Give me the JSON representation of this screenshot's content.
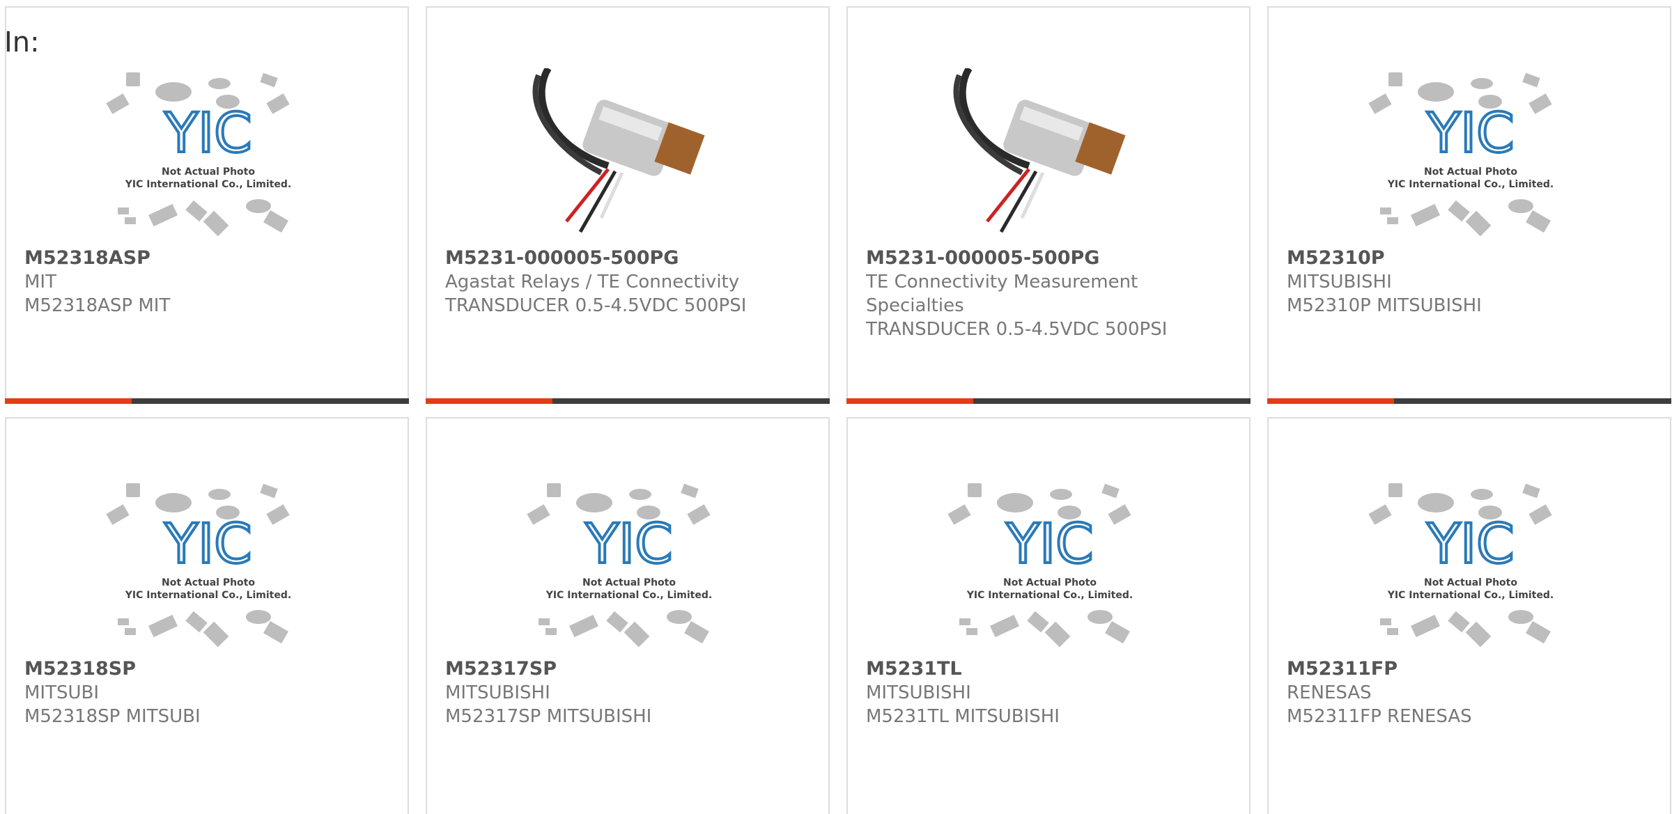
{
  "page": {
    "intro_text": "In:"
  },
  "colors": {
    "accent": "#e53c13",
    "bar_dark": "#3d3d3d",
    "card_border": "#dddddd",
    "logo_blue": "#2a7ab8"
  },
  "placeholder_image": {
    "icon": "yic-placeholder-image",
    "caption_line1": "Not Actual Photo",
    "caption_line2": "YIC International Co., Limited."
  },
  "products": [
    {
      "part": "M52318ASP",
      "mfr": "MIT",
      "desc": "M52318ASP MIT",
      "image": "yic-placeholder-image"
    },
    {
      "part": "M5231-000005-500PG",
      "mfr": "Agastat Relays / TE Connectivity",
      "desc": "TRANSDUCER 0.5-4.5VDC 500PSI",
      "image": "pressure-transducer-photo"
    },
    {
      "part": "M5231-000005-500PG",
      "mfr": "TE Connectivity Measurement Specialties",
      "desc": "TRANSDUCER 0.5-4.5VDC 500PSI",
      "image": "pressure-transducer-photo"
    },
    {
      "part": "M52310P",
      "mfr": "MITSUBISHI",
      "desc": "M52310P MITSUBISHI",
      "image": "yic-placeholder-image"
    },
    {
      "part": "M52318SP",
      "mfr": "MITSUBI",
      "desc": "M52318SP MITSUBI",
      "image": "yic-placeholder-image"
    },
    {
      "part": "M52317SP",
      "mfr": "MITSUBISHI",
      "desc": "M52317SP MITSUBISHI",
      "image": "yic-placeholder-image"
    },
    {
      "part": "M5231TL",
      "mfr": "MITSUBISHI",
      "desc": "M5231TL MITSUBISHI",
      "image": "yic-placeholder-image"
    },
    {
      "part": "M52311FP",
      "mfr": "RENESAS",
      "desc": "M52311FP RENESAS",
      "image": "yic-placeholder-image"
    }
  ]
}
